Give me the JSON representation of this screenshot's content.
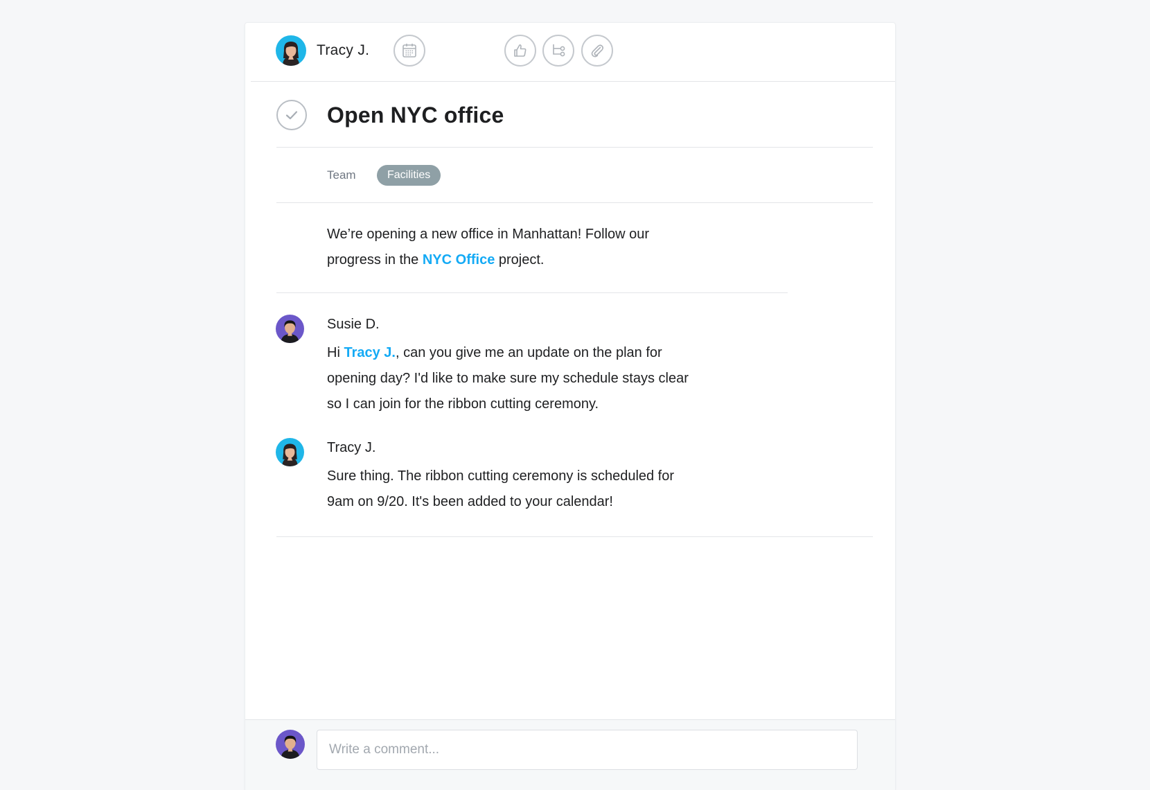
{
  "header": {
    "assignee_name": "Tracy J.",
    "icons": [
      "calendar-icon",
      "thumbs-up-icon",
      "subtask-icon",
      "paperclip-icon"
    ]
  },
  "task": {
    "title": "Open NYC office",
    "team_label": "Team",
    "team_value": "Facilities",
    "description": {
      "before_link": "We’re opening a new office in Manhattan! Follow our progress in the ",
      "link_text": "NYC Office",
      "after_link": " project."
    }
  },
  "comments": [
    {
      "author": "Susie D.",
      "before_mention": "Hi ",
      "mention": "Tracy J.",
      "after_mention": ", can you give me an update on the plan for opening day? I'd like to make sure my schedule stays clear so I can join for the ribbon cutting ceremony."
    },
    {
      "author": "Tracy J.",
      "body": "Sure thing. The ribbon cutting ceremony is scheduled for 9am on 9/20. It's been added to your calendar!"
    }
  ],
  "composer": {
    "placeholder": "Write a comment..."
  },
  "colors": {
    "accent_link": "#14aaf5",
    "team_chip": "#8fa0a6",
    "avatar_tracy_bg": "#1fb6e8",
    "avatar_susie_bg": "#6b57c9"
  }
}
